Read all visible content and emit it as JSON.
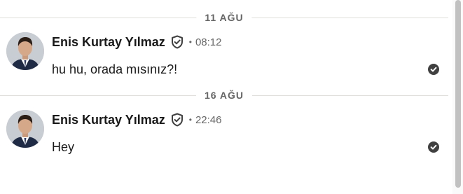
{
  "conversation": {
    "groups": [
      {
        "date_label": "11 AĞU",
        "message": {
          "sender_name": "Enis Kurtay Yılmaz",
          "separator": "•",
          "time": "08:12",
          "text": "hu hu, orada mısınız?!"
        }
      },
      {
        "date_label": "16 AĞU",
        "message": {
          "sender_name": "Enis Kurtay Yılmaz",
          "separator": "•",
          "time": "22:46",
          "text": "Hey"
        }
      }
    ]
  },
  "icons": {
    "verified": "shield-check-icon",
    "read_receipt": "check-circle-icon"
  },
  "colors": {
    "text_primary": "#191919",
    "text_secondary": "#666666",
    "divider": "#e0dfdc",
    "icon": "#404040"
  }
}
